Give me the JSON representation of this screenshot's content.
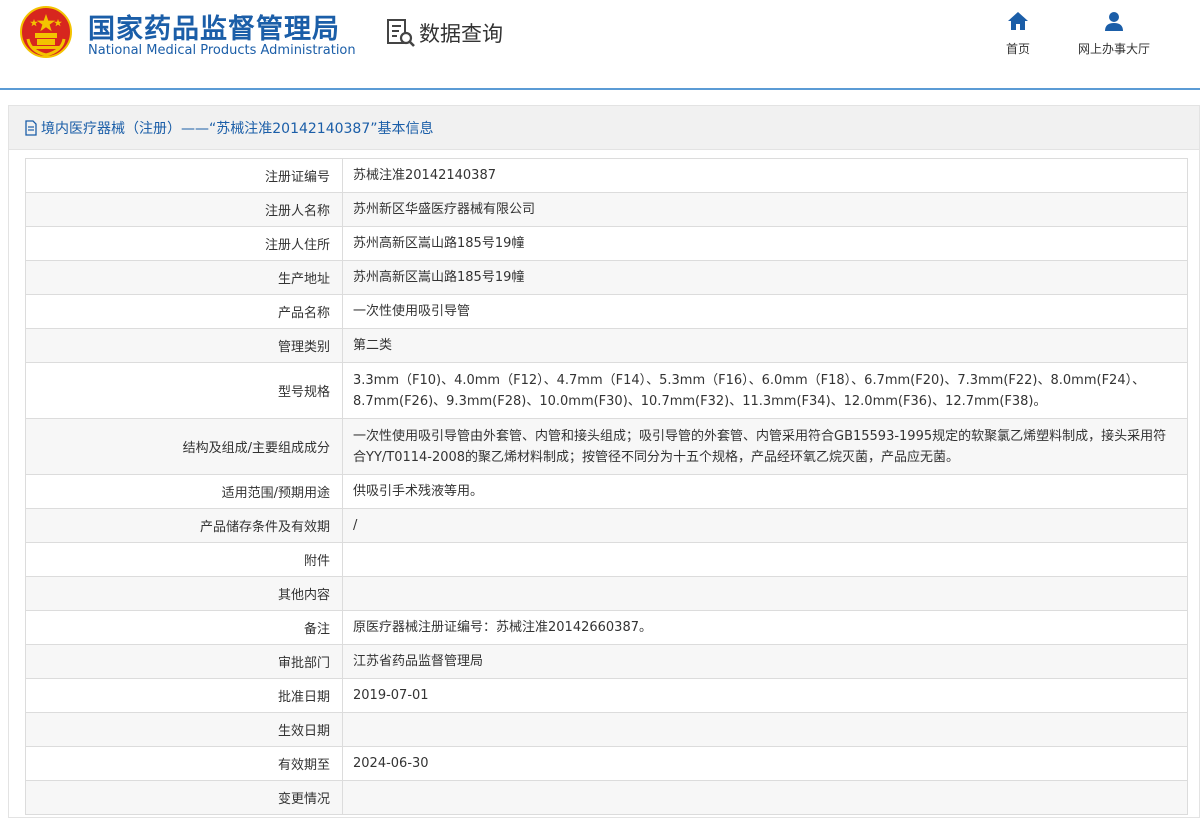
{
  "header": {
    "brand_cn": "国家药品监督管理局",
    "brand_en": "National Medical Products Administration",
    "query_label": "数据查询",
    "nav": [
      {
        "label": "首页",
        "icon": "home-icon"
      },
      {
        "label": "网上办事大厅",
        "icon": "user-icon"
      }
    ]
  },
  "panel": {
    "title": "境内医疗器械（注册）——“苏械注准20142140387”基本信息"
  },
  "rows": [
    {
      "key": "注册证编号",
      "value": "苏械注准20142140387"
    },
    {
      "key": "注册人名称",
      "value": "苏州新区华盛医疗器械有限公司"
    },
    {
      "key": "注册人住所",
      "value": "苏州高新区嵩山路185号19幢"
    },
    {
      "key": "生产地址",
      "value": "苏州高新区嵩山路185号19幢"
    },
    {
      "key": "产品名称",
      "value": "一次性使用吸引导管"
    },
    {
      "key": "管理类别",
      "value": "第二类"
    },
    {
      "key": "型号规格",
      "value": "3.3mm（F10)、4.0mm（F12）、4.7mm（F14）、5.3mm（F16）、6.0mm（F18）、6.7mm(F20)、7.3mm(F22)、8.0mm(F24）、8.7mm(F26)、9.3mm(F28)、10.0mm(F30)、10.7mm(F32)、11.3mm(F34)、12.0mm(F36)、12.7mm(F38)。"
    },
    {
      "key": "结构及组成/主要组成成分",
      "value": "一次性使用吸引导管由外套管、内管和接头组成；吸引导管的外套管、内管采用符合GB15593-1995规定的软聚氯乙烯塑料制成，接头采用符合YY/T0114-2008的聚乙烯材料制成；按管径不同分为十五个规格，产品经环氧乙烷灭菌，产品应无菌。"
    },
    {
      "key": "适用范围/预期用途",
      "value": "供吸引手术残液等用。"
    },
    {
      "key": "产品储存条件及有效期",
      "value": "/"
    },
    {
      "key": "附件",
      "value": ""
    },
    {
      "key": "其他内容",
      "value": ""
    },
    {
      "key": "备注",
      "value": "原医疗器械注册证编号：苏械注准20142660387。"
    },
    {
      "key": "审批部门",
      "value": "江苏省药品监督管理局"
    },
    {
      "key": "批准日期",
      "value": "2019-07-01"
    },
    {
      "key": "生效日期",
      "value": ""
    },
    {
      "key": "有效期至",
      "value": "2024-06-30"
    },
    {
      "key": "变更情况",
      "value": ""
    }
  ],
  "colors": {
    "brand_blue": "#1b5ea8",
    "accent_line": "#5b9bd5",
    "emblem_red": "#d7261e",
    "emblem_gold": "#f3c300"
  }
}
